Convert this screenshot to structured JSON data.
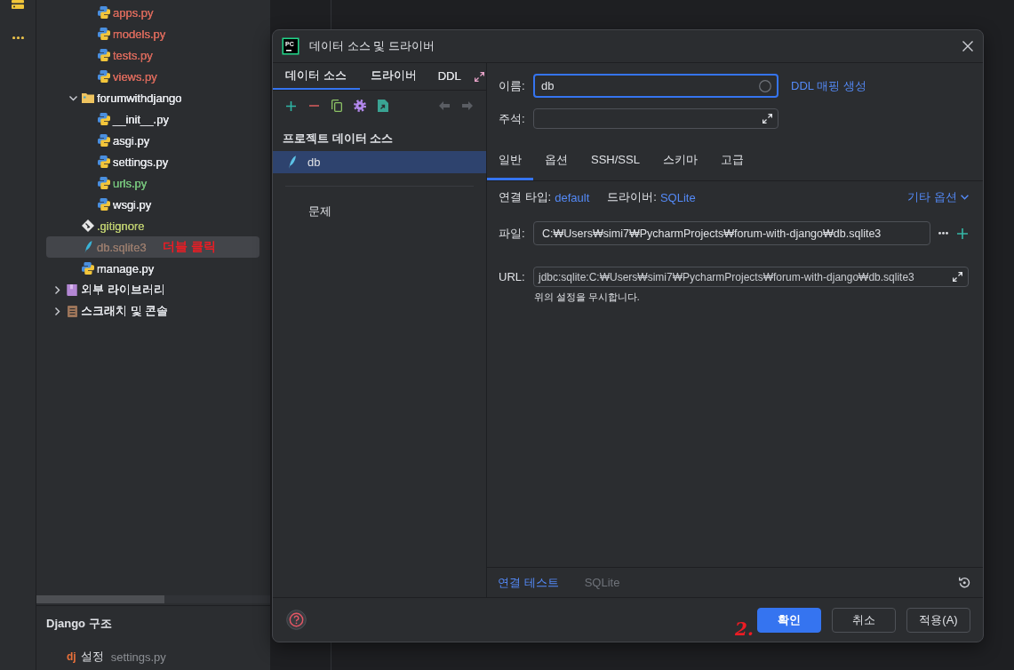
{
  "project_tree": {
    "items": [
      {
        "children": [
          {
            "children": [
              {
                "label": "apps.py",
                "kind": "python",
                "color": "#d1675a",
                "selected": false
              },
              {
                "label": "models.py",
                "kind": "python",
                "color": "#d1675a",
                "selected": false
              },
              {
                "label": "tests.py",
                "kind": "python",
                "color": "#d1675a",
                "selected": false
              },
              {
                "label": "views.py",
                "kind": "python",
                "color": "#d1675a",
                "selected": false
              }
            ]
          },
          {
            "label": "forumwithdjango",
            "kind": "folder",
            "color": "#dfe1e5",
            "selected": false,
            "expanded": true,
            "children": [
              {
                "label": "__init__.py",
                "kind": "python",
                "color": "#dfe1e5",
                "selected": false
              },
              {
                "label": "asgi.py",
                "kind": "python",
                "color": "#dfe1e5",
                "selected": false
              },
              {
                "label": "settings.py",
                "kind": "python",
                "color": "#dfe1e5",
                "selected": false
              },
              {
                "label": "urls.py",
                "kind": "python",
                "color": "#73bd79",
                "selected": false
              },
              {
                "label": "wsgi.py",
                "kind": "python",
                "color": "#dfe1e5",
                "selected": false
              }
            ]
          },
          {
            "label": ".gitignore",
            "kind": "git",
            "color": "#b5c46c",
            "selected": false
          },
          {
            "label": "db.sqlite3",
            "kind": "sqlite",
            "color": "#94796b",
            "selected": true,
            "annotation": "더블 클릭"
          },
          {
            "label": "manage.py",
            "kind": "python",
            "color": "#dfe1e5",
            "selected": false
          }
        ]
      },
      {
        "label": "외부 라이브러리",
        "kind": "library",
        "color": "#dfe1e5",
        "selected": false,
        "expanded": false
      },
      {
        "label": "스크래치 및 콘솔",
        "kind": "scratch",
        "color": "#dfe1e5",
        "selected": false,
        "expanded": false
      }
    ]
  },
  "structure_panel": {
    "title": "Django 구조",
    "items": [
      {
        "logo": "dj",
        "label": "설정",
        "file": "settings.py"
      }
    ]
  },
  "dialog": {
    "logo": "PC",
    "title": "데이터 소스 및 드라이버",
    "left_tabs": [
      {
        "label": "데이터 소스",
        "selected": true
      },
      {
        "label": "드라이버",
        "selected": false
      },
      {
        "label": "DDL",
        "selected": false
      }
    ],
    "toolbar": [
      {
        "kind": "add",
        "disabled": false
      },
      {
        "kind": "remove",
        "disabled": false
      },
      {
        "kind": "copy",
        "disabled": false
      },
      {
        "kind": "settings",
        "disabled": false
      },
      {
        "kind": "export",
        "disabled": false
      },
      {
        "kind": "back",
        "disabled": true
      },
      {
        "kind": "forward",
        "disabled": true
      }
    ],
    "section_title": "프로젝트 데이터 소스",
    "data_sources": [
      {
        "label": "db",
        "selected": true
      }
    ],
    "problems_label": "문제",
    "name_field": {
      "label": "이름:",
      "value": "db"
    },
    "ddl_mapping_link": "DDL 매핑 생성",
    "comment_field": {
      "label": "주석:"
    },
    "tabs": [
      {
        "label": "일반",
        "selected": true
      },
      {
        "label": "옵션",
        "selected": false
      },
      {
        "label": "SSH/SSL",
        "selected": false
      },
      {
        "label": "스키마",
        "selected": false
      },
      {
        "label": "고급",
        "selected": false
      }
    ],
    "connection_type": {
      "label": "연결 타입:",
      "value": "default"
    },
    "driver": {
      "label": "드라이버:",
      "value": "SQLite"
    },
    "more_options_link": "기타 옵션",
    "file_field": {
      "label": "파일:",
      "value": "C:₩Users₩simi7₩PycharmProjects₩forum-with-django₩db.sqlite3"
    },
    "url_field": {
      "label": "URL:",
      "value": "jdbc:sqlite:C:₩Users₩simi7₩PycharmProjects₩forum-with-django₩db.sqlite3",
      "hint": "위의 설정을 무시합니다."
    },
    "test_connection_link": "연결 테스트",
    "driver_status": "SQLite",
    "annotation": "2.",
    "buttons": [
      {
        "label": "확인",
        "kind": "primary"
      },
      {
        "label": "취소",
        "kind": "secondary"
      },
      {
        "label": "적용(A)",
        "kind": "secondary"
      }
    ]
  }
}
